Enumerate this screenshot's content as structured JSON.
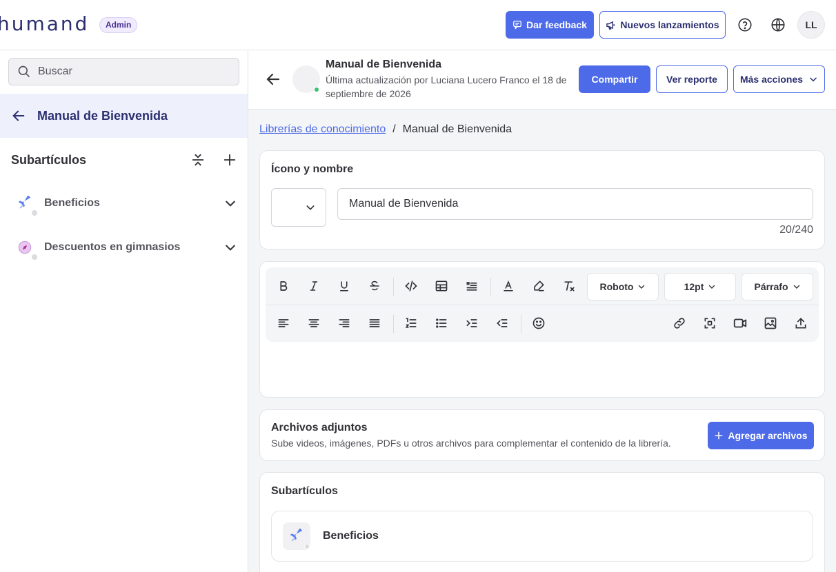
{
  "header": {
    "logo_text": "humand",
    "admin_badge": "Admin",
    "feedback_label": "Dar feedback",
    "releases_label": "Nuevos lanzamientos",
    "avatar_initials": "LL"
  },
  "sidebar": {
    "search_placeholder": "Buscar",
    "title": "Manual de Bienvenida",
    "subarticles_label": "Subartículos",
    "items": [
      {
        "label": "Beneficios",
        "icon": "airplane-emoji"
      },
      {
        "label": "Descuentos en gimnasios",
        "icon": "compass-emoji"
      }
    ]
  },
  "main": {
    "doc_title": "Manual de Bienvenida",
    "doc_subtitle": "Última actualización por Luciana Lucero Franco el 18 de septiembre de 2026",
    "share_label": "Compartir",
    "report_label": "Ver reporte",
    "more_label": "Más acciones",
    "breadcrumb": {
      "link": "Librerías de conocimiento",
      "separator": "/",
      "current": "Manual de Bienvenida"
    },
    "icon_name_card": {
      "title": "Ícono y nombre",
      "name_value": "Manual de Bienvenida",
      "counter": "20/240"
    },
    "editor": {
      "font_family": "Roboto",
      "font_size": "12pt",
      "block_type": "Párrafo"
    },
    "attachments": {
      "title": "Archivos adjuntos",
      "description": "Sube videos, imágenes, PDFs u otros archivos para complementar el contenido de la librería.",
      "add_label": "Agregar archivos"
    },
    "subarticles": {
      "title": "Subartículos",
      "items": [
        {
          "label": "Beneficios"
        }
      ]
    }
  },
  "colors": {
    "primary": "#4d6ae8",
    "navy": "#2b2f70",
    "online": "#3cc16b"
  }
}
